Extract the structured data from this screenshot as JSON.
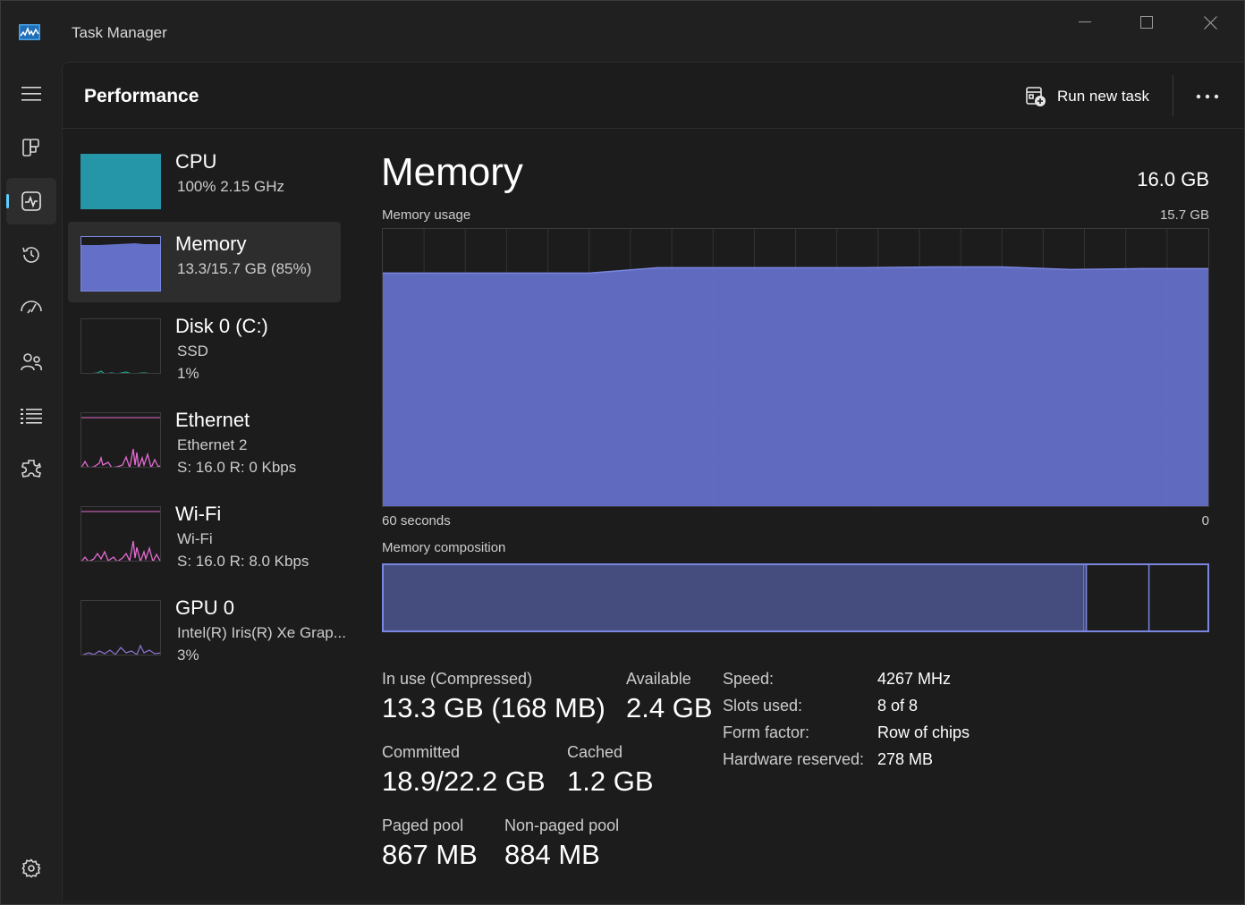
{
  "window": {
    "title": "Task Manager"
  },
  "header": {
    "title": "Performance",
    "run_task_label": "Run new task",
    "more_icon": "ellipsis-icon"
  },
  "nav": {
    "items": [
      {
        "name": "menu",
        "icon": "hamburger-icon"
      },
      {
        "name": "processes",
        "icon": "processes-icon"
      },
      {
        "name": "performance",
        "icon": "performance-icon",
        "active": true
      },
      {
        "name": "app-history",
        "icon": "history-icon"
      },
      {
        "name": "startup-apps",
        "icon": "startup-icon"
      },
      {
        "name": "users",
        "icon": "users-icon"
      },
      {
        "name": "details",
        "icon": "details-list-icon"
      },
      {
        "name": "services",
        "icon": "services-icon"
      },
      {
        "name": "settings",
        "icon": "gear-icon"
      }
    ]
  },
  "resources": [
    {
      "name": "CPU",
      "line1": "100%  2.15 GHz",
      "line2": "",
      "color": "#2596a8",
      "level_fraction": 1.0
    },
    {
      "name": "Memory",
      "line1": "13.3/15.7 GB (85%)",
      "line2": "",
      "color": "#6470c8",
      "level_fraction": 0.85
    },
    {
      "name": "Disk 0 (C:)",
      "line1": "SSD",
      "line2": "1%",
      "color": "#1fa38a"
    },
    {
      "name": "Ethernet",
      "line1": "Ethernet 2",
      "line2": "S: 16.0  R: 0 Kbps",
      "color": "#e26bd0"
    },
    {
      "name": "Wi-Fi",
      "line1": "Wi-Fi",
      "line2": "S: 16.0  R: 8.0 Kbps",
      "color": "#e26bd0"
    },
    {
      "name": "GPU 0",
      "line1": "Intel(R) Iris(R) Xe Grap...",
      "line2": "3%",
      "color": "#8a70c8"
    }
  ],
  "detail": {
    "title": "Memory",
    "total": "16.0 GB",
    "usage_label": "Memory usage",
    "usage_max": "15.7 GB",
    "axis_left": "60 seconds",
    "axis_right": "0",
    "composition_label": "Memory composition",
    "composition_fractions": {
      "in_use": 0.85,
      "modified": 0.003,
      "standby": 0.076,
      "free": 0.071
    },
    "stats": {
      "in_use_label": "In use (Compressed)",
      "in_use_value": "13.3 GB (168 MB)",
      "available_label": "Available",
      "available_value": "2.4 GB",
      "committed_label": "Committed",
      "committed_value": "18.9/22.2 GB",
      "cached_label": "Cached",
      "cached_value": "1.2 GB",
      "paged_label": "Paged pool",
      "paged_value": "867 MB",
      "nonpaged_label": "Non-paged pool",
      "nonpaged_value": "884 MB"
    },
    "specs": {
      "speed_label": "Speed:",
      "speed_value": "4267 MHz",
      "slots_label": "Slots used:",
      "slots_value": "8 of 8",
      "form_label": "Form factor:",
      "form_value": "Row of chips",
      "reserved_label": "Hardware reserved:",
      "reserved_value": "278 MB"
    }
  },
  "colors": {
    "accent": "#60cdff",
    "memory_fill": "#6470c8",
    "memory_line": "#7a86e0",
    "composition_in_use": "#454d7f"
  },
  "chart_data": {
    "type": "area",
    "title": "Memory usage",
    "xlabel": "60 seconds",
    "ylabel": "",
    "ylim": [
      0,
      15.7
    ],
    "x": [
      60,
      55,
      50,
      45,
      40,
      35,
      30,
      25,
      20,
      15,
      10,
      5,
      0
    ],
    "series": [
      {
        "values": [
          13.2,
          13.2,
          13.2,
          13.2,
          13.5,
          13.5,
          13.5,
          13.5,
          13.55,
          13.55,
          13.4,
          13.45,
          13.45
        ]
      }
    ],
    "grid": true
  }
}
